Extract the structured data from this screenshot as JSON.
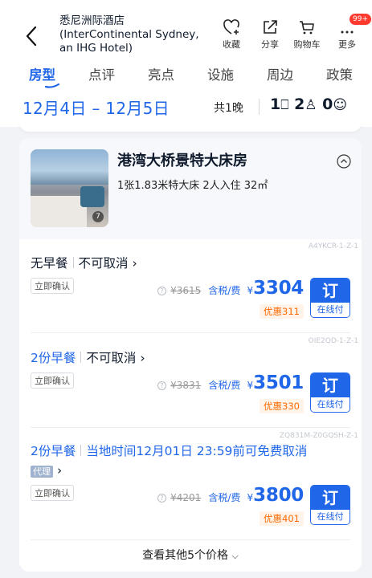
{
  "header": {
    "hotel_name_cn": "悉尼洲际酒店",
    "hotel_name_en": "(InterContinental Sydney, an IHG Hotel)",
    "icons": [
      {
        "name": "heart-plus-icon",
        "label": "收藏"
      },
      {
        "name": "share-icon",
        "label": "分享"
      },
      {
        "name": "cart-icon",
        "label": "购物车"
      },
      {
        "name": "more-icon",
        "label": "更多",
        "badge": "99+"
      }
    ]
  },
  "tabs": [
    "房型",
    "点评",
    "亮点",
    "设施",
    "周边",
    "政策"
  ],
  "active_tab": "房型",
  "dates": {
    "range": "12月4日 – 12月5日",
    "nights": "共1晚",
    "rooms": "1",
    "adults": "2",
    "children": "0"
  },
  "room": {
    "name": "港湾大桥景特大床房",
    "desc": "1张1.83米特大床  2人入住  32㎡",
    "photo_count": "7"
  },
  "offers": [
    {
      "code": "A4YKCR-1-Z-1",
      "meal": "无早餐",
      "cancel": "不可取消",
      "confirm": "立即确认",
      "original_price": "¥3615",
      "tax_label": "含税/费",
      "currency": "¥",
      "price": "3304",
      "discount": "优惠311",
      "book": "订",
      "pay": "在线付"
    },
    {
      "code": "OIE2QD-1-Z-1",
      "meal": "2份早餐",
      "cancel": "不可取消",
      "confirm": "立即确认",
      "original_price": "¥3831",
      "tax_label": "含税/费",
      "currency": "¥",
      "price": "3501",
      "discount": "优惠330",
      "book": "订",
      "pay": "在线付"
    },
    {
      "code": "ZQ831M-Z0GQSH-Z-1",
      "meal": "2份早餐",
      "cancel": "当地时间12月01日 23:59前可免费取消",
      "agent": "代理",
      "confirm": "立即确认",
      "original_price": "¥4201",
      "tax_label": "含税/费",
      "currency": "¥",
      "price": "3800",
      "discount": "优惠401",
      "book": "订",
      "pay": "在线付"
    }
  ],
  "more_prices": "查看其他5个价格",
  "colors": {
    "accent": "#2066e8",
    "discount": "#ff6a00",
    "badge": "#ff3b30"
  }
}
